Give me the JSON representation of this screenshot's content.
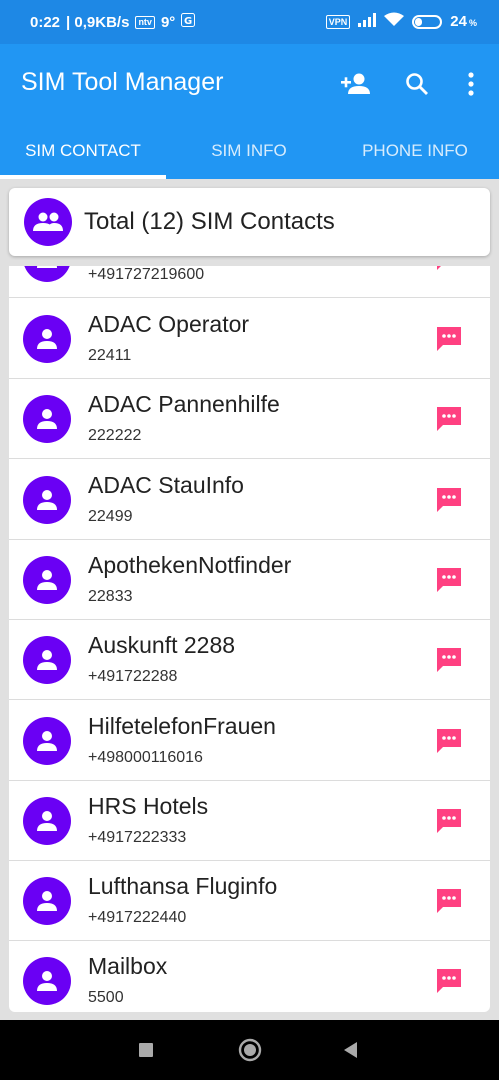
{
  "status_bar": {
    "time": "0:22",
    "speed": "| 0,9KB/s",
    "network_chip": "ntv",
    "temperature": "9°",
    "vpn": "VPN",
    "battery": "24",
    "battery_unit": "%",
    "battery_level": 0.24
  },
  "app_bar": {
    "title": "SIM Tool Manager",
    "icons": [
      "add-contact-icon",
      "search-icon",
      "more-vert-icon"
    ]
  },
  "tabs": [
    {
      "label": "SIM CONTACT",
      "active": true
    },
    {
      "label": "SIM INFO",
      "active": false
    },
    {
      "label": "PHONE INFO",
      "active": false
    }
  ],
  "summary": {
    "text": "Total (12) SIM Contacts"
  },
  "partial_contact": {
    "number": "+491727219600"
  },
  "contacts": [
    {
      "name": "ADAC Operator",
      "number": "22411"
    },
    {
      "name": "ADAC Pannenhilfe",
      "number": "222222"
    },
    {
      "name": "ADAC StauInfo",
      "number": "22499"
    },
    {
      "name": "ApothekenNotfinder",
      "number": "22833"
    },
    {
      "name": "Auskunft 2288",
      "number": "+491722288"
    },
    {
      "name": "HilfetelefonFrauen",
      "number": "+498000116016"
    },
    {
      "name": "HRS Hotels",
      "number": "+4917222333"
    },
    {
      "name": "Lufthansa Fluginfo",
      "number": "+4917222440"
    },
    {
      "name": "Mailbox",
      "number": "5500"
    }
  ],
  "colors": {
    "status_bar": "#1e88e5",
    "app_bar": "#2196f3",
    "avatar": "#6a00f4",
    "message_icon": "#ff4081"
  }
}
